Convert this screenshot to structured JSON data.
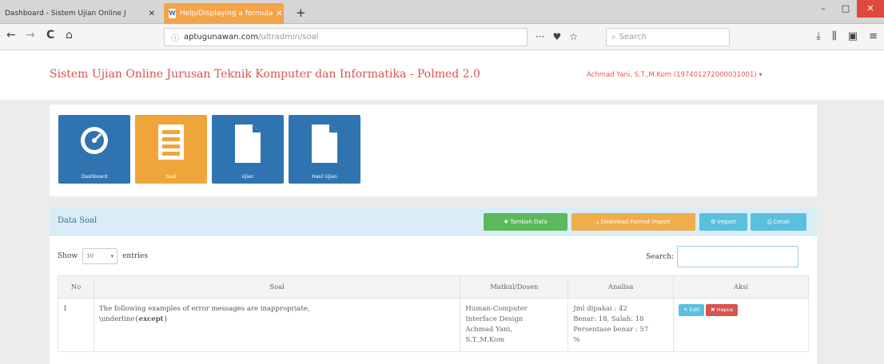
{
  "browser": {
    "tabs": [
      {
        "label": "Dashboard - Sistem Ujian Online J",
        "close": "✕"
      },
      {
        "favicon": "W",
        "label": "Help/Displaying a formula",
        "close": "✕"
      }
    ],
    "new_tab": "+",
    "window_controls": {
      "minimize": "–",
      "maximize": "□",
      "close": "✕"
    },
    "nav": {
      "back": "←",
      "forward": "→",
      "reload": "C",
      "home": "⌂"
    },
    "url": {
      "domain": "aptugunawan.com",
      "path": "/ultradmin/soal"
    },
    "url_icons": {
      "more": "···",
      "pocket": "♥",
      "bookmark": "☆"
    },
    "search_placeholder": "Search",
    "toolbar_icons": {
      "download": "⤓",
      "library": "⫼",
      "sidebar": "▣",
      "menu": "≡"
    }
  },
  "site": {
    "title": "Sistem Ujian Online Jurusan Teknik Komputer dan Informatika - Polmed 2.0",
    "user": "Achmad Yani, S.T.,M.Kom (197401272000031001) ▾"
  },
  "tiles": [
    {
      "label": "Dashboard",
      "icon": "dashboard-icon"
    },
    {
      "label": "Soal",
      "icon": "list-icon"
    },
    {
      "label": "Ujian",
      "icon": "document-icon"
    },
    {
      "label": "Hasil Ujian",
      "icon": "document-icon"
    }
  ],
  "panel": {
    "title": "Data Soal",
    "buttons": {
      "add": "✚  Tambah Data",
      "download": "⤓  Download Format Import",
      "import": "⚙  Import",
      "print": "⎙  Cetak"
    }
  },
  "table_controls": {
    "show_label": "Show",
    "entries_value": "10",
    "entries_label": "entries",
    "search_label": "Search:"
  },
  "table": {
    "headers": [
      "No",
      "Soal",
      "Matkul/Dosen",
      "Analisa",
      "Aksi"
    ],
    "rows": [
      {
        "no": "1",
        "soal_text": "The following examples of error messages are inappropriate,",
        "soal_underline_prefix": "\\underline{",
        "soal_bold": "except",
        "soal_underline_suffix": "}",
        "matkul_line1": "Human-Computer",
        "matkul_line2": "Interface Design",
        "dosen_line1": "Achmad Yani,",
        "dosen_line2": "S.T.,M.Kom",
        "analisa_line1": "Jml dipakai : 42",
        "analisa_line2": "Benar: 18, Salah: 18",
        "analisa_line3": "Persentase benar : 57",
        "analisa_line4": "%",
        "edit_label": "✎ Edit",
        "delete_label": "✖ Hapus"
      }
    ]
  },
  "colors": {
    "title_red": "#d9534f",
    "tile_blue": "#2f74b0",
    "tile_orange": "#f0a53b",
    "panel_head": "#d9edf7",
    "success": "#5cb85c",
    "warning": "#f0ad4e",
    "info": "#5bc0de",
    "danger": "#d9534f"
  }
}
